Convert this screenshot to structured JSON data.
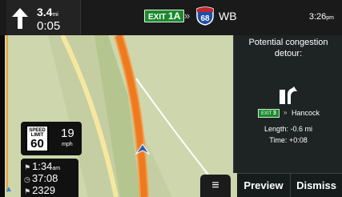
{
  "topbar": {
    "turn_distance": "3.4",
    "turn_distance_unit": "mi",
    "turn_time": "0:05",
    "exit_label": "EXIT",
    "exit_number": "1A",
    "road_separator": "»",
    "interstate_number": "68",
    "road_direction": "WB",
    "clock": "3:26",
    "clock_suffix": "pm"
  },
  "speed": {
    "limit_title": "SPEED LIMIT",
    "limit_value": "60",
    "current": "19",
    "current_unit": "mph"
  },
  "trip": {
    "arrival_time": "1:34",
    "arrival_suffix": "am",
    "remaining_time": "37:08",
    "remaining_distance": "2329"
  },
  "detour_panel": {
    "title": "Potential congestion detour:",
    "exit_label": "EXIT",
    "exit_number": "3",
    "separator": "»",
    "destination": "Hancock",
    "length": "Length: -0.6 mi",
    "time": "Time: +0:08"
  },
  "buttons": {
    "menu_icon": "≡",
    "preview": "Preview",
    "dismiss": "Dismiss"
  },
  "colors": {
    "route": "#ee7a1f",
    "exit_green": "#1b8a2d",
    "interstate_blue": "#1f4fa8",
    "panel_bg": "#1e2423"
  }
}
